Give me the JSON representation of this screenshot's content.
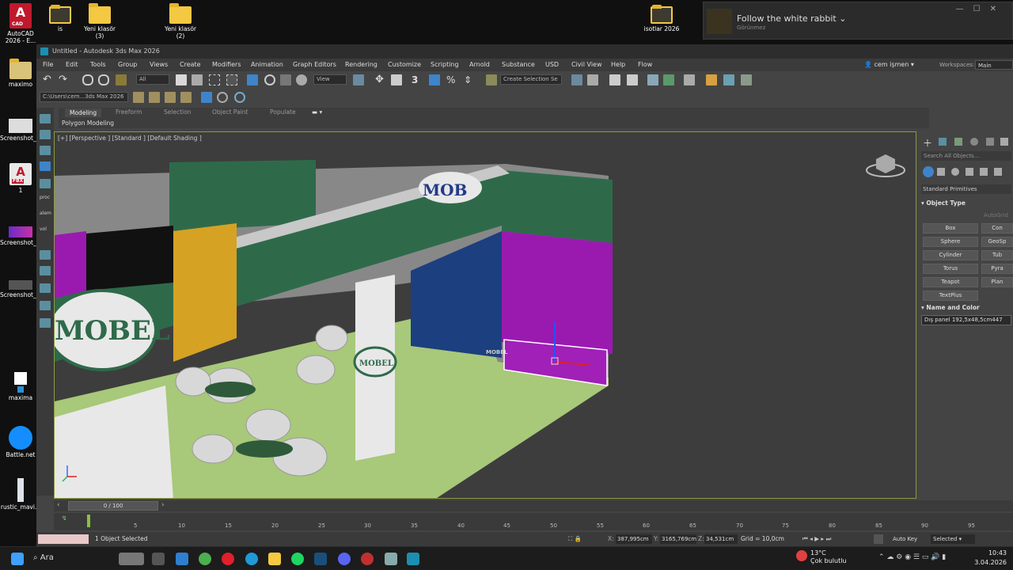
{
  "desktop": {
    "icons_left": [
      {
        "label": "AutoCAD 2026 - E..."
      },
      {
        "label": "maximo"
      },
      {
        "label": "Screenshot_..."
      },
      {
        "label": "1"
      },
      {
        "label": "Screenshot_..."
      },
      {
        "label": "Screenshot_..."
      },
      {
        "label": "maxima"
      },
      {
        "label": "Battle.net"
      },
      {
        "label": "rustic_mavi..."
      }
    ],
    "icons_top": [
      {
        "label": "is"
      },
      {
        "label": "Yeni klasör (3)"
      },
      {
        "label": "Yeni klasör (2)"
      },
      {
        "label": "isotlar 2026"
      }
    ],
    "badges": {
      "autocad": "A",
      "autocad_sub": "CAD",
      "fbx": "A",
      "fbx_sub": "FBX",
      "script1": "proc",
      "script2": "alem",
      "script3": "vol"
    }
  },
  "notification": {
    "title": "Follow the white rabbit",
    "subtitle": "Görünmez"
  },
  "window": {
    "title": "Untitled - Autodesk 3ds Max 2026",
    "menu": [
      "File",
      "Edit",
      "Tools",
      "Group",
      "Views",
      "Create",
      "Modifiers",
      "Animation",
      "Graph Editors",
      "Rendering",
      "Customize",
      "Scripting",
      "Arnold",
      "Substance",
      "USD",
      "Civil View",
      "Help",
      "Flow"
    ],
    "user": "cem işmen",
    "workspaces_label": "Workspaces:",
    "workspace": "Main Toolbar",
    "toolbar": {
      "selection_filter": "All",
      "ref_coord": "View",
      "selection_set": "Create Selection Se",
      "snap_value": "3",
      "path": "C:\\Users\\cem...3ds Max 2026"
    },
    "ribbon": {
      "tabs": [
        "Modeling",
        "Freeform",
        "Selection",
        "Object Paint",
        "Populate"
      ],
      "active": "Modeling",
      "sub": "Polygon Modeling"
    },
    "viewport": {
      "label": "[+] [Perspective ] [Standard ] [Default Shading ]",
      "brand": "MOBEL",
      "brand_partial": "MOB",
      "brand_partial2": "MOBE",
      "brand_small": "MOBEL",
      "brand_small2": "MOBEL"
    },
    "command_panel": {
      "search_placeholder": "Search All Objects...",
      "category": "Standard Primitives",
      "object_type_header": "Object Type",
      "autogrid": "AutoGrid",
      "buttons": [
        "Box",
        "Cone",
        "Sphere",
        "GeoSphere",
        "Cylinder",
        "Tube",
        "Torus",
        "Pyramid",
        "Teapot",
        "Plane",
        "TextPlus"
      ],
      "buttons_visible": [
        "Box",
        "Con",
        "Sphere",
        "GeoSp",
        "Cylinder",
        "Tub",
        "Torus",
        "Pyra",
        "Teapot",
        "Plan",
        "TextPlus"
      ],
      "name_color_header": "Name and Color",
      "name": "Dış panel 192,5x48,5cm447"
    },
    "time": {
      "frame": "0 / 100",
      "ticks": [
        "5",
        "10",
        "15",
        "20",
        "25",
        "30",
        "35",
        "40",
        "45",
        "50",
        "55",
        "60",
        "65",
        "70",
        "75",
        "80",
        "85",
        "90",
        "95"
      ]
    },
    "status": {
      "selected": "1 Object Selected",
      "x_label": "X:",
      "x": "387,995cm",
      "y_label": "Y:",
      "y": "3165,769cm",
      "z_label": "Z:",
      "z": "34,531cm",
      "grid": "Grid = 10,0cm",
      "autokey": "Auto Key",
      "selected_dd": "Selected"
    }
  },
  "taskbar": {
    "search": "Ara",
    "weather_temp": "13°C",
    "weather_desc": "Çok bulutlu",
    "time": "10:43",
    "date": "3.04.2026"
  }
}
